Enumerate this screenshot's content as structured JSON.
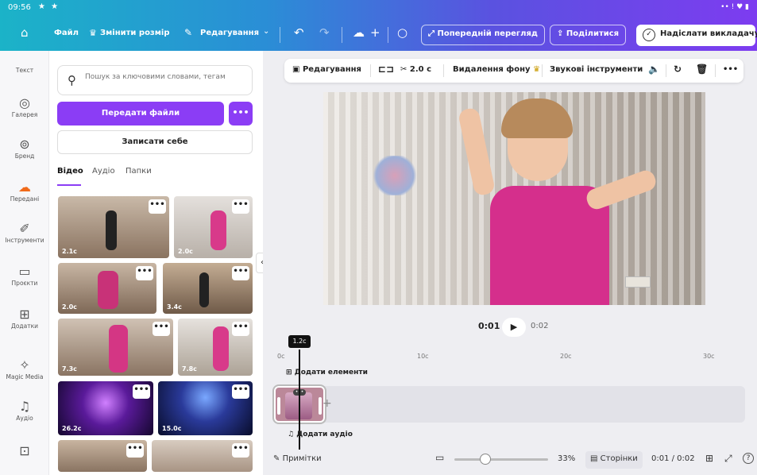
{
  "status": {
    "time": "09:56",
    "stars": "★ ★",
    "right": "•• ! ♥ ▮"
  },
  "toolbar": {
    "file": "Файл",
    "resize": "Змінити розмір",
    "edit": "Редагування",
    "preview": "Попередній перегляд",
    "share": "Поділитися",
    "submit": "Надіслати викладачу"
  },
  "rail": [
    {
      "label": "Текст",
      "icon": "text-icon"
    },
    {
      "label": "Галерея",
      "icon": "gallery-icon"
    },
    {
      "label": "Бренд",
      "icon": "brand-icon"
    },
    {
      "label": "Передані",
      "icon": "uploads-icon"
    },
    {
      "label": "Інструменти",
      "icon": "tools-icon"
    },
    {
      "label": "Проєкти",
      "icon": "projects-icon"
    },
    {
      "label": "Додатки",
      "icon": "apps-icon"
    },
    {
      "label": "Magic Media",
      "icon": "magic-media-icon"
    },
    {
      "label": "Аудіо",
      "icon": "audio-icon"
    },
    {
      "label": "",
      "icon": "more-icon"
    }
  ],
  "panel": {
    "search_placeholder": "Пошук за ключовими словами, тегам",
    "upload": "Передати файли",
    "more": "•••",
    "record": "Записати себе",
    "tabs": [
      "Відео",
      "Аудіо",
      "Папки"
    ]
  },
  "thumbs": [
    {
      "duration": "2.1с"
    },
    {
      "duration": "2.0с"
    },
    {
      "duration": "2.0с"
    },
    {
      "duration": "3.4с"
    },
    {
      "duration": "7.3с"
    },
    {
      "duration": "7.8с"
    },
    {
      "duration": "26.2с"
    },
    {
      "duration": "15.0с"
    },
    {
      "duration": ""
    },
    {
      "duration": ""
    }
  ],
  "context_toolbar": {
    "edit": "Редагування",
    "duration": "2.0 с",
    "bg_remove": "Видалення фону",
    "audio_tools": "Звукові інструменти",
    "more": "•••"
  },
  "player": {
    "current": "0:01",
    "total": "0:02"
  },
  "timeline": {
    "playhead_label": "1.2с",
    "ticks": [
      "0с",
      "10с",
      "20с",
      "30с"
    ],
    "add_elements": "Додати елементи",
    "add_audio": "Додати аудіо"
  },
  "bottom": {
    "notes": "Примітки",
    "zoom": "33%",
    "pages": "Сторінки",
    "time": "0:01 / 0:02",
    "help": "?"
  }
}
